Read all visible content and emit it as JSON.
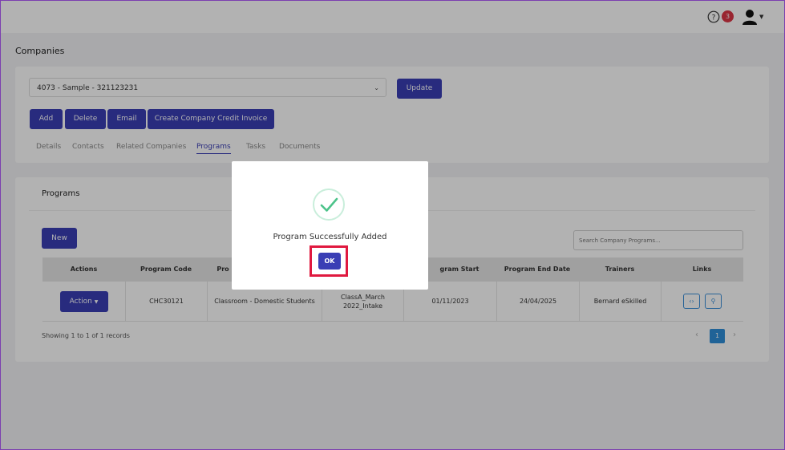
{
  "topbar": {
    "notification_count": "3"
  },
  "page_title": "Companies",
  "company": {
    "selected": "4073 - Sample - 321123231",
    "update_label": "Update"
  },
  "toolbar": {
    "add_label": "Add",
    "delete_label": "Delete",
    "email_label": "Email",
    "credit_invoice_label": "Create Company Credit Invoice"
  },
  "tabs": [
    {
      "label": "Details"
    },
    {
      "label": "Contacts"
    },
    {
      "label": "Related Companies"
    },
    {
      "label": "Programs",
      "active": true
    },
    {
      "label": "Tasks"
    },
    {
      "label": "Documents"
    }
  ],
  "programs": {
    "heading": "Programs",
    "new_label": "New",
    "search_placeholder": "Search Company Programs...",
    "columns": [
      "Actions",
      "Program Code",
      "Pro",
      "",
      "gram Start Date",
      "Program End Date",
      "Trainers",
      "Links"
    ],
    "rows": [
      {
        "action_label": "Action",
        "program_code": "CHC30121",
        "program_type": "Classroom - Domestic Students",
        "intake_line1": "ClassA_March",
        "intake_line2": "2022_Intake",
        "start_date": "01/11/2023",
        "end_date": "24/04/2025",
        "trainers": "Bernard eSkilled"
      }
    ],
    "showing_text": "Showing 1 to 1 of 1 records",
    "current_page": "1"
  },
  "modal": {
    "message": "Program Successfully Added",
    "ok_label": "OK"
  },
  "colors": {
    "primary": "#3a3eb5",
    "badge": "#dc3545",
    "success": "#4cc38a",
    "highlight": "#e0193f",
    "pager": "#2f8fd8"
  }
}
